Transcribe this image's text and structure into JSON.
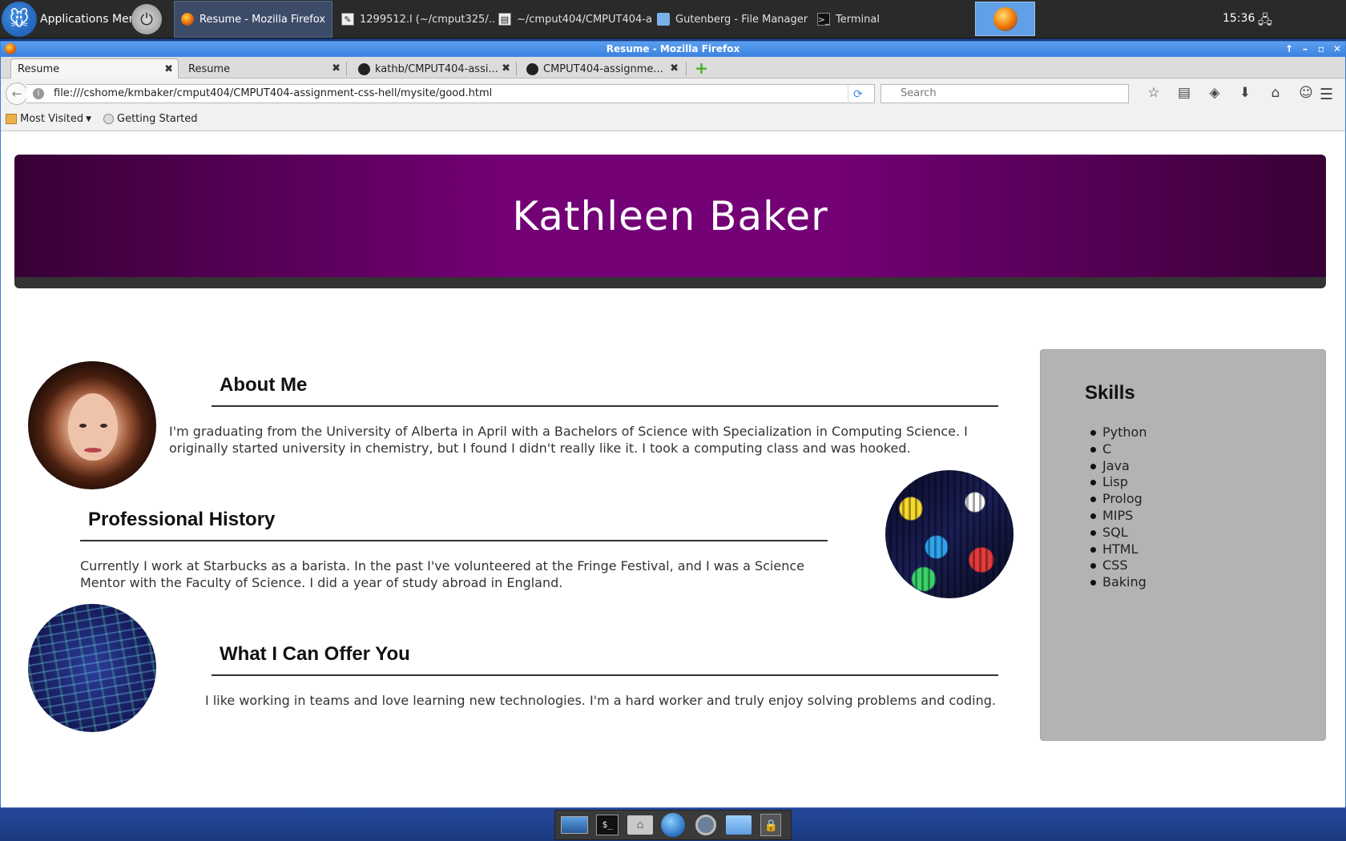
{
  "top_panel": {
    "app_menu_label": "Applications Menu",
    "tasks": [
      "Resume - Mozilla Firefox",
      "1299512.l (~/cmput325/...",
      "~/cmput404/CMPUT404-a...",
      "Gutenberg - File Manager",
      "Terminal"
    ],
    "clock": "15:36"
  },
  "window": {
    "title": "Resume - Mozilla Firefox"
  },
  "tabs": [
    {
      "label": "Resume"
    },
    {
      "label": "Resume"
    },
    {
      "label": "kathb/CMPUT404-assi..."
    },
    {
      "label": "CMPUT404-assignme..."
    }
  ],
  "navbar": {
    "url": "file:///cshome/kmbaker/cmput404/CMPUT404-assignment-css-hell/mysite/good.html",
    "search_placeholder": "Search"
  },
  "bookmarks": {
    "most_visited": "Most Visited",
    "getting_started": "Getting Started"
  },
  "page": {
    "name": "Kathleen Baker",
    "about": {
      "title": "About Me",
      "text_line1": "I'm graduating from the University of Alberta in April with a Bachelors of Science with Specialization in Computing Science. I",
      "text_line2": "originally started university in chemistry, but I found I didn't really like it. I took a computing class and was hooked."
    },
    "history": {
      "title": "Professional History",
      "text_line1": "Currently I work at Starbucks as a barista. In the past I've volunteered at the Fringe Festival, and I was a Science",
      "text_line2": "Mentor with the Faculty of Science. I did a year of study abroad in England."
    },
    "offer": {
      "title": "What I Can Offer You",
      "text": "I like working in teams and love learning new technologies. I'm a hard worker and truly enjoy solving problems and coding."
    },
    "skills": {
      "title": "Skills",
      "items": [
        "Python",
        "C",
        "Java",
        "Lisp",
        "Prolog",
        "MIPS",
        "SQL",
        "HTML",
        "CSS",
        "Baking"
      ]
    }
  },
  "colors": {
    "banner_dark": "#380036",
    "banner_light": "#740076",
    "skills_panel": "#b3b3b3"
  }
}
